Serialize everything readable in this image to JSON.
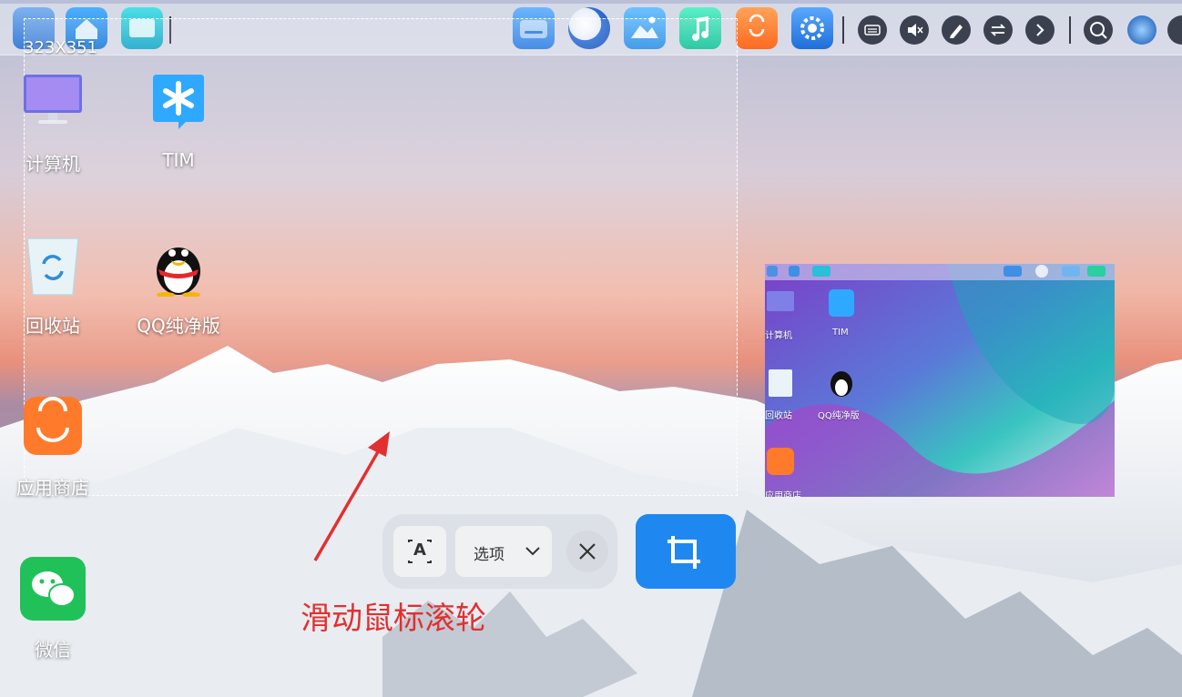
{
  "selection": {
    "size_label": "323X351"
  },
  "desktop": {
    "items": [
      {
        "label": "计算机",
        "icon": "computer-icon"
      },
      {
        "label": "TIM",
        "icon": "tim-icon"
      },
      {
        "label": "回收站",
        "icon": "recycle-bin-icon"
      },
      {
        "label": "QQ纯净版",
        "icon": "qq-icon"
      },
      {
        "label": "应用商店",
        "icon": "app-store-icon"
      },
      {
        "label": "微信",
        "icon": "wechat-icon"
      }
    ]
  },
  "toolbar": {
    "options_label": "选项",
    "ocr_glyph": "A"
  },
  "annotation": {
    "text": "滑动鼠标滚轮"
  },
  "preview": {
    "labels": [
      "计算机",
      "TIM",
      "回收站",
      "QQ纯净版",
      "应用商店"
    ]
  },
  "colors": {
    "accent": "#1e88f0",
    "annotation": "#e23030"
  }
}
